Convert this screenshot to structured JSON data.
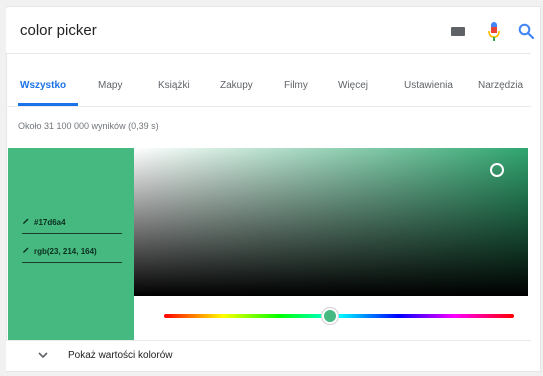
{
  "search": {
    "query": "color picker"
  },
  "tabs": [
    {
      "label": "Wszystko",
      "active": true
    },
    {
      "label": "Mapy"
    },
    {
      "label": "Książki"
    },
    {
      "label": "Zakupy"
    },
    {
      "label": "Filmy"
    },
    {
      "label": "Więcej"
    },
    {
      "label": "Ustawienia"
    },
    {
      "label": "Narzędzia"
    }
  ],
  "results_stats": "Około 31 100 000 wyników (0,39 s)",
  "color_picker": {
    "hex": "#17d6a4",
    "rgb": "rgb(23, 214, 164)",
    "show_values_label": "Pokaż wartości kolorów"
  },
  "colors": {
    "swatch": "#45b97f",
    "accent_blue": "#1a73e8",
    "mic_red": "#ea4335",
    "mic_yellow": "#fbbc05"
  },
  "icons": {
    "keyboard": "keyboard-icon",
    "mic": "mic-icon",
    "search": "search-icon",
    "pen": "pen-icon",
    "chevron": "chevron-down-icon"
  }
}
